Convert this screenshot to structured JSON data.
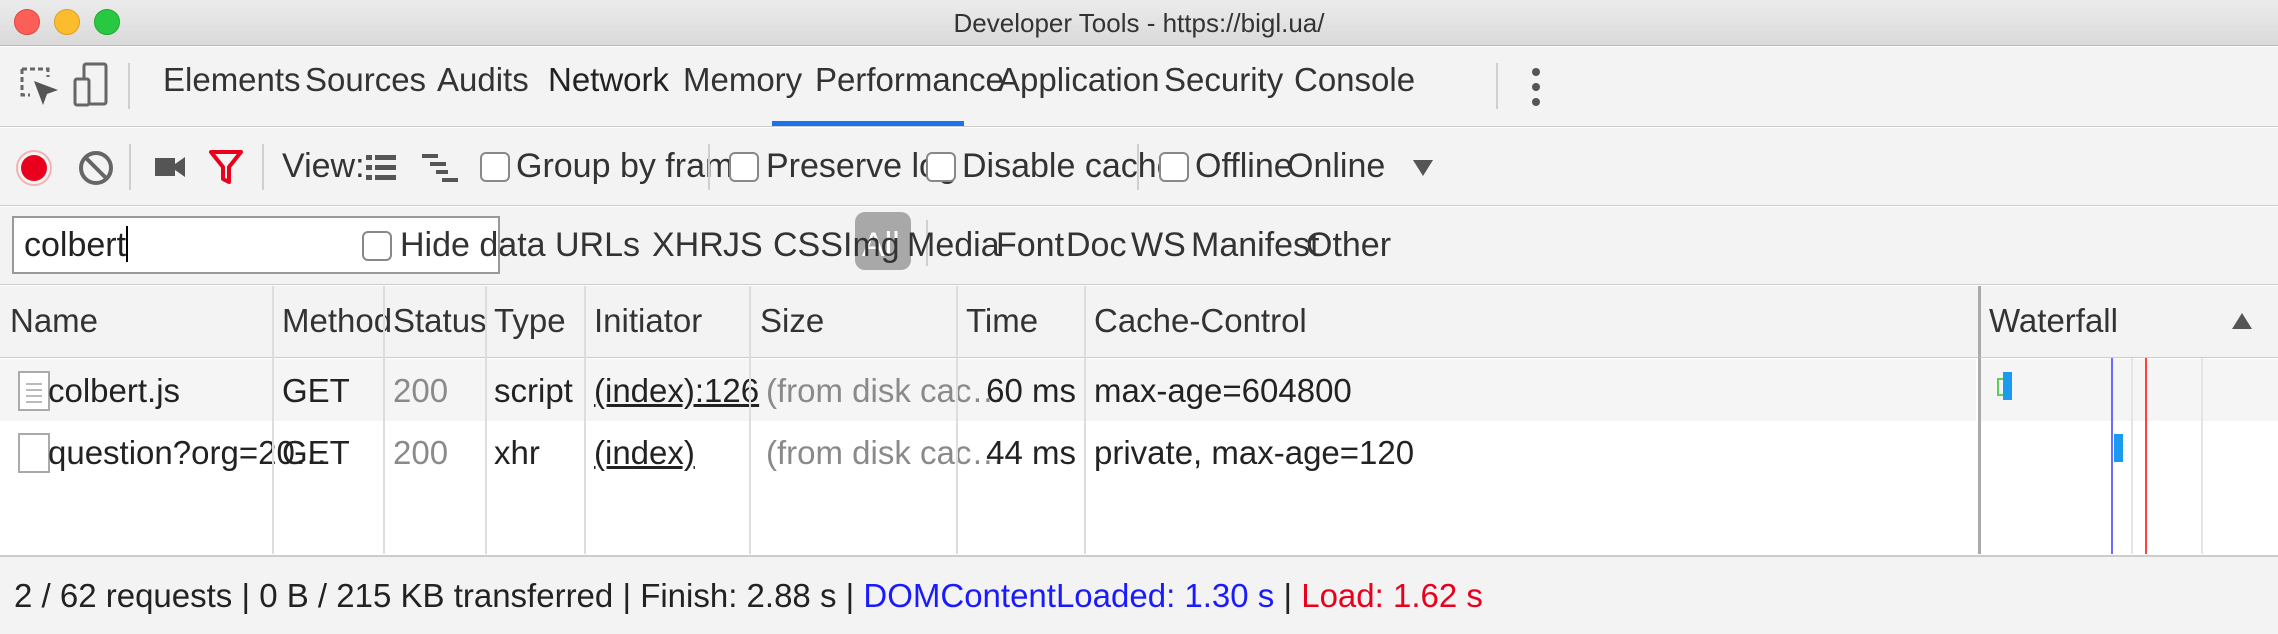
{
  "window": {
    "title": "Developer Tools - https://bigl.ua/"
  },
  "tabs": [
    "Elements",
    "Sources",
    "Audits",
    "Network",
    "Memory",
    "Performance",
    "Application",
    "Security",
    "Console"
  ],
  "active_tab": "Network",
  "toolbar": {
    "view_label": "View:",
    "group_by_frame": "Group by frame",
    "preserve_log": "Preserve log",
    "disable_cache": "Disable cache",
    "offline": "Offline",
    "throttle": "Online"
  },
  "filter": {
    "value": "colbert",
    "hide_data_urls": "Hide data URLs",
    "types": [
      "All",
      "XHR",
      "JS",
      "CSS",
      "Img",
      "Media",
      "Font",
      "Doc",
      "WS",
      "Manifest",
      "Other"
    ],
    "selected_type": "All"
  },
  "table": {
    "columns": [
      "Name",
      "Method",
      "Status",
      "Type",
      "Initiator",
      "Size",
      "Time",
      "Cache-Control",
      "Waterfall"
    ],
    "rows": [
      {
        "name": "colbert.js",
        "method": "GET",
        "status": "200",
        "type": "script",
        "initiator": "(index):126",
        "size": "(from disk cac…",
        "time": "60 ms",
        "cache": "max-age=604800"
      },
      {
        "name": "question?org=20…",
        "method": "GET",
        "status": "200",
        "type": "xhr",
        "initiator": "(index)",
        "size": "(from disk cac…",
        "time": "44 ms",
        "cache": "private, max-age=120"
      }
    ]
  },
  "status": {
    "requests": "2 / 62 requests",
    "transferred": "0 B / 215 KB transferred",
    "finish": "Finish: 2.88 s",
    "dom": "DOMContentLoaded: 1.30 s",
    "load": "Load: 1.62 s",
    "sep": "|",
    "dom_color": "#1a1aff",
    "load_color": "#e8001c"
  },
  "icons": [
    "inspect-icon",
    "device-toolbar-icon",
    "more-vert-icon",
    "record-icon",
    "clear-icon",
    "screenshot-icon",
    "filter-icon",
    "large-rows-icon",
    "overview-icon",
    "dropdown-icon",
    "sort-icon",
    "file-icon"
  ],
  "colors": {
    "accent": "#1a73e8",
    "record": "#e8001c",
    "filter": "#e8001c"
  }
}
